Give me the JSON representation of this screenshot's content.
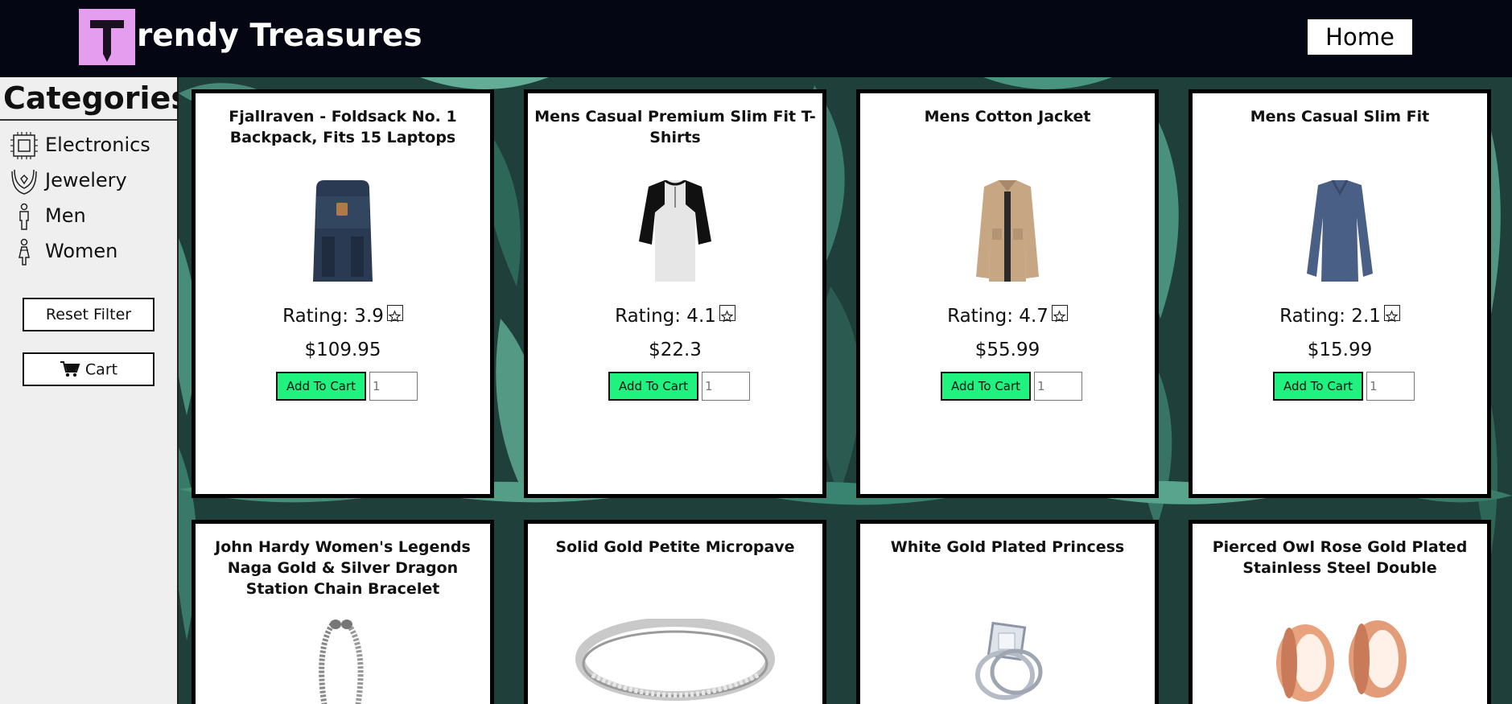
{
  "header": {
    "logo_letter": "T",
    "brand": "rendy Treasures",
    "home_label": "Home"
  },
  "sidebar": {
    "title": "Categories",
    "items": [
      {
        "label": "Electronics",
        "icon": "chip-icon"
      },
      {
        "label": "Jewelery",
        "icon": "necklace-icon"
      },
      {
        "label": "Men",
        "icon": "man-icon"
      },
      {
        "label": "Women",
        "icon": "woman-icon"
      }
    ],
    "reset_label": "Reset Filter",
    "cart_label": "Cart"
  },
  "products": [
    {
      "title": "Fjallraven - Foldsack No. 1 Backpack, Fits 15 Laptops",
      "rating": "Rating: 3.9",
      "price": "$109.95",
      "add_label": "Add To Cart",
      "qty_placeholder": "1"
    },
    {
      "title": "Mens Casual Premium Slim Fit T-Shirts",
      "rating": "Rating: 4.1",
      "price": "$22.3",
      "add_label": "Add To Cart",
      "qty_placeholder": "1"
    },
    {
      "title": "Mens Cotton Jacket",
      "rating": "Rating: 4.7",
      "price": "$55.99",
      "add_label": "Add To Cart",
      "qty_placeholder": "1"
    },
    {
      "title": "Mens Casual Slim Fit",
      "rating": "Rating: 2.1",
      "price": "$15.99",
      "add_label": "Add To Cart",
      "qty_placeholder": "1"
    },
    {
      "title": "John Hardy Women's Legends Naga Gold & Silver Dragon Station Chain Bracelet"
    },
    {
      "title": "Solid Gold Petite Micropave"
    },
    {
      "title": "White Gold Plated Princess"
    },
    {
      "title": "Pierced Owl Rose Gold Plated Stainless Steel Double"
    }
  ],
  "colors": {
    "header_bg": "#040614",
    "logo_bg": "#e59df0",
    "add_to_cart": "#1ff27f",
    "sidebar_bg": "#efefef"
  }
}
